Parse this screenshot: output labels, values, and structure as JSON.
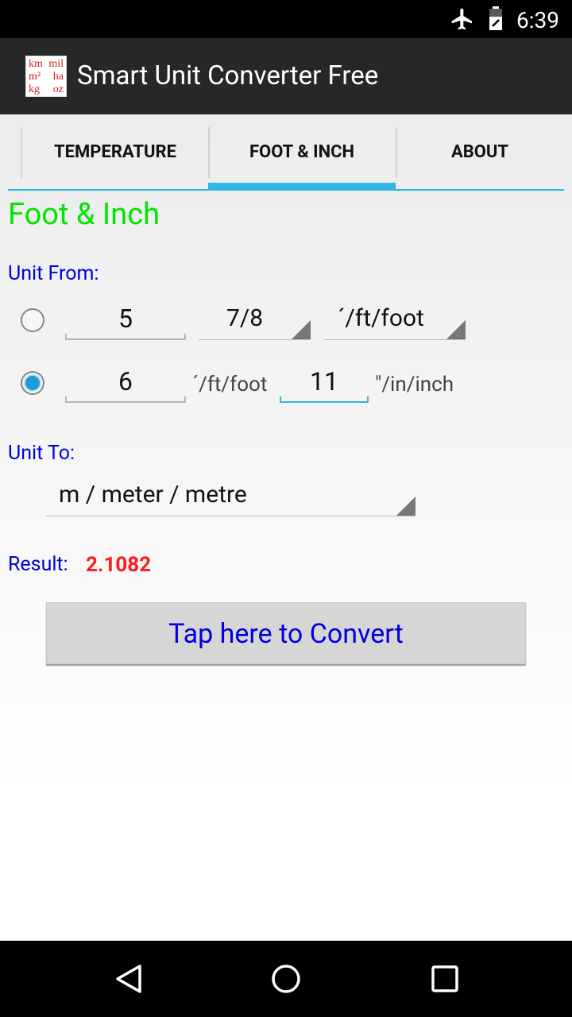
{
  "status_bar": {
    "time": "6:39",
    "icons": [
      "airplane-mode-icon",
      "battery-icon"
    ]
  },
  "app": {
    "title": "Smart Unit Converter Free",
    "icon_text": [
      [
        "km",
        "mil"
      ],
      [
        "m²",
        "ha"
      ],
      [
        "kg",
        "oz"
      ]
    ]
  },
  "tabs": [
    {
      "label": "TEMPERATURE",
      "active": false
    },
    {
      "label": "FOOT & INCH",
      "active": true
    },
    {
      "label": "ABOUT",
      "active": false
    }
  ],
  "section": {
    "title": "Foot & Inch"
  },
  "unit_from": {
    "label": "Unit From:",
    "row1": {
      "selected": false,
      "value": "5",
      "fraction": "7/8",
      "unit": "´/ft/foot"
    },
    "row2": {
      "selected": true,
      "feet_value": "6",
      "feet_unit": "´/ft/foot",
      "inch_value": "11",
      "inch_unit": "\"/in/inch"
    }
  },
  "unit_to": {
    "label": "Unit To:",
    "selected": "m / meter / metre"
  },
  "result": {
    "label": "Result:",
    "value": "2.1082"
  },
  "convert_button": {
    "label": "Tap here to Convert"
  },
  "colors": {
    "accent": "#33b5e5",
    "title_green": "#00e600",
    "label_blue": "#0000dd",
    "result_red": "#ff1a1a"
  }
}
